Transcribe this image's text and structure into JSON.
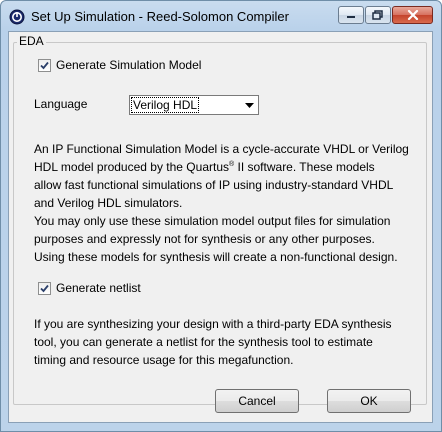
{
  "window": {
    "title": "Set Up Simulation - Reed-Solomon Compiler",
    "icon": "app-icon",
    "controls": [
      "minimize-icon",
      "maximize-icon",
      "close-icon"
    ]
  },
  "group": {
    "label": "EDA"
  },
  "generate_model": {
    "label": "Generate Simulation Model",
    "checked": true
  },
  "language": {
    "label": "Language",
    "selected": "Verilog HDL"
  },
  "description": {
    "line1": "An IP Functional Simulation Model is a cycle-accurate VHDL or Verilog",
    "line2_before": "HDL model produced by the Quartus",
    "line2_sup": "®",
    "line2_after": " II software. These models",
    "line3": "allow fast functional simulations of IP using industry-standard VHDL",
    "line4": "and Verilog HDL simulators.",
    "line5": "You may only use these simulation model output files for simulation",
    "line6": "purposes and expressly not for synthesis or any other purposes.",
    "line7": "Using these models for synthesis will create a non-functional design."
  },
  "generate_netlist": {
    "label": "Generate netlist",
    "checked": true
  },
  "netlist_description": {
    "line1": "If you are synthesizing your design with a third-party EDA synthesis",
    "line2": "tool, you can generate a netlist for the synthesis tool to estimate",
    "line3": "timing and resource usage for this megafunction."
  },
  "buttons": {
    "cancel": "Cancel",
    "ok": "OK"
  },
  "colors": {
    "titlebar": "#b9d1ea",
    "dialog_bg": "#f0f0f0",
    "close_button": "#c4432c"
  }
}
